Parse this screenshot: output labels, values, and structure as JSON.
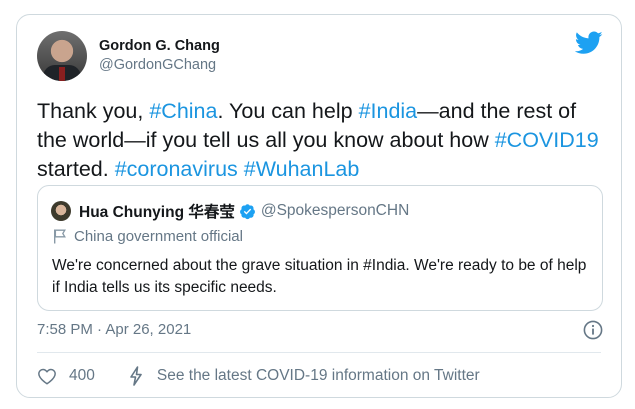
{
  "author": {
    "name": "Gordon G. Chang",
    "handle": "@GordonGChang"
  },
  "tweet": {
    "parts": [
      {
        "text": "Thank you, ",
        "tag": false
      },
      {
        "text": "#China",
        "tag": true
      },
      {
        "text": ". You can help ",
        "tag": false
      },
      {
        "text": "#India",
        "tag": true
      },
      {
        "text": "—and the rest of the world—if you tell us all you know about how ",
        "tag": false
      },
      {
        "text": "#COVID19",
        "tag": true
      },
      {
        "text": " started. ",
        "tag": false
      },
      {
        "text": "#coronavirus",
        "tag": true
      },
      {
        "text": " ",
        "tag": false
      },
      {
        "text": "#WuhanLab",
        "tag": true
      }
    ],
    "timestamp": "7:58 PM · Apr 26, 2021"
  },
  "quote": {
    "name": "Hua Chunying 华春莹",
    "handle": "@SpokespersonCHN",
    "label": "China government official",
    "text": "We're concerned about the grave situation in #India. We're ready to be of help if India tells us its specific needs."
  },
  "footer": {
    "like_count": "400",
    "covid_link": "See the latest COVID-19 information on Twitter"
  },
  "colors": {
    "accent": "#1b95e0",
    "muted": "#657786",
    "text": "#14171a",
    "border": "#cfd9de"
  },
  "icons": [
    "twitter-bird-icon",
    "verified-badge-icon",
    "government-flag-icon",
    "info-icon",
    "heart-icon",
    "lightning-bolt-icon"
  ]
}
